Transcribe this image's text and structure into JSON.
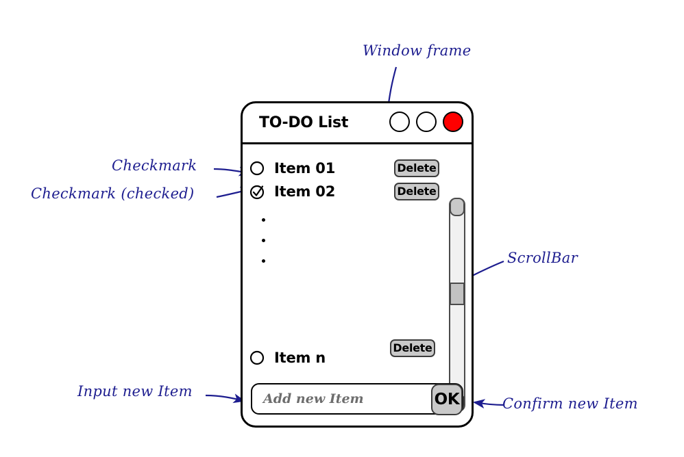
{
  "window": {
    "title": "TO-DO List",
    "controls": [
      {
        "name": "minimize",
        "color": "#ffffff"
      },
      {
        "name": "maximize",
        "color": "#ffffff"
      },
      {
        "name": "close",
        "color": "#ff0000"
      }
    ]
  },
  "list": {
    "items": [
      {
        "label": "Item 01",
        "checked": false,
        "delete_label": "Delete"
      },
      {
        "label": "Item 02",
        "checked": true,
        "delete_label": "Delete"
      },
      {
        "label": "Item n",
        "checked": false,
        "delete_label": "Delete"
      }
    ],
    "ellipsis_dot_count": 3
  },
  "scrollbar": {
    "up_arrow": "scroll-up",
    "down_arrow": "scroll-down",
    "thumb": "scroll-thumb"
  },
  "input": {
    "placeholder": "Add new Item",
    "value": "",
    "confirm_label": "OK"
  },
  "annotations": {
    "accent_color": "#1d1d8f",
    "items": [
      {
        "id": "window-frame",
        "text": "Window frame"
      },
      {
        "id": "checkmark",
        "text": "Checkmark"
      },
      {
        "id": "checkmark-checked",
        "text": "Checkmark (checked)"
      },
      {
        "id": "scrollbar",
        "text": "ScrollBar"
      },
      {
        "id": "input-new-item",
        "text": "Input new Item"
      },
      {
        "id": "confirm-new-item",
        "text": "Confirm new Item"
      }
    ]
  }
}
